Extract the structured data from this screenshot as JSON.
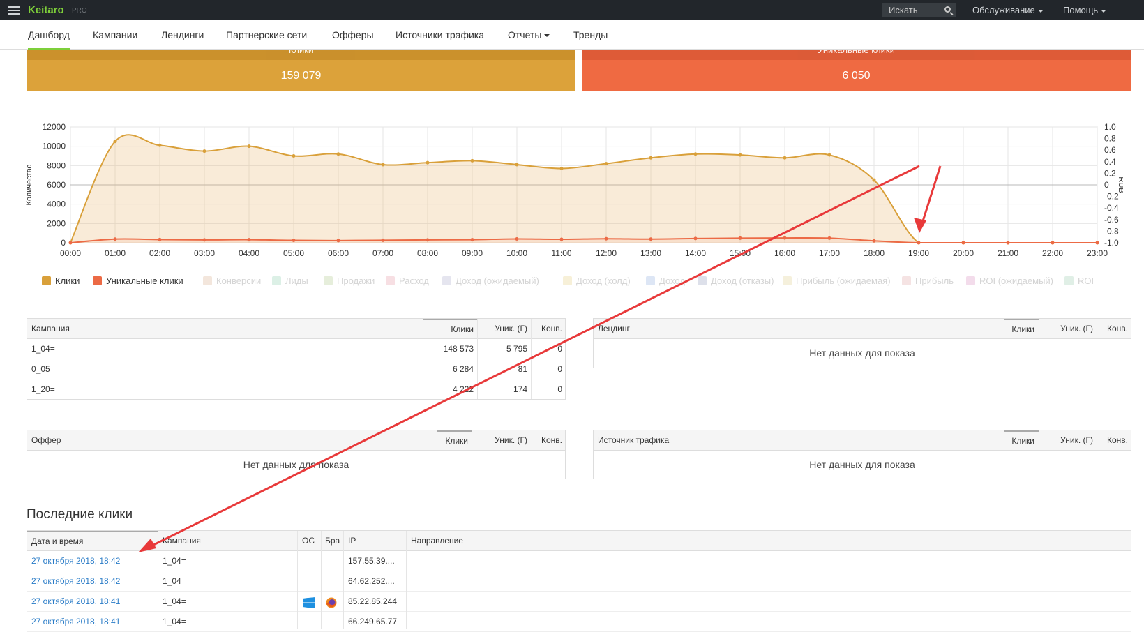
{
  "app": {
    "brand": "Keitaro",
    "edition": "PRO"
  },
  "topnav": {
    "search_label": "Искать",
    "service_label": "Обслуживание",
    "help_label": "Помощь"
  },
  "menu": [
    "Дашборд",
    "Кампании",
    "Лендинги",
    "Партнерские сети",
    "Офферы",
    "Источники трафика",
    "Отчеты",
    "Тренды"
  ],
  "cards": [
    {
      "title": "Клики",
      "value": "159 079"
    },
    {
      "title": "Уникальные клики",
      "value": "6 050"
    }
  ],
  "chart_data": {
    "type": "area",
    "x": [
      "00:00",
      "01:00",
      "02:00",
      "03:00",
      "04:00",
      "05:00",
      "06:00",
      "07:00",
      "08:00",
      "09:00",
      "10:00",
      "11:00",
      "12:00",
      "13:00",
      "14:00",
      "15:00",
      "16:00",
      "17:00",
      "18:00",
      "19:00",
      "20:00",
      "21:00",
      "22:00",
      "23:00"
    ],
    "series": [
      {
        "name": "Клики",
        "values": [
          0,
          10500,
          10100,
          9500,
          10000,
          9000,
          9200,
          8100,
          8300,
          8500,
          8100,
          7700,
          8200,
          8800,
          9200,
          9100,
          8800,
          9100,
          6500,
          0,
          0,
          0,
          0,
          0
        ],
        "color": "#d9a03a"
      },
      {
        "name": "Уникальные клики",
        "values": [
          0,
          380,
          330,
          300,
          320,
          250,
          230,
          260,
          300,
          320,
          400,
          360,
          420,
          380,
          440,
          480,
          500,
          480,
          200,
          0,
          0,
          0,
          0,
          0
        ],
        "color": "#ec6a45"
      }
    ],
    "ylabel": "Количество",
    "y2label": "RUB",
    "ylim": [
      0,
      12000
    ],
    "yticks": [
      0,
      2000,
      4000,
      6000,
      8000,
      10000,
      12000
    ],
    "y2ticks": [
      "-1.0",
      "-0.8",
      "-0.6",
      "-0.4",
      "-0.2",
      "0",
      "0.2",
      "0.4",
      "0.6",
      "0.8",
      "1.0"
    ],
    "grid": true,
    "legend": [
      {
        "label": "Клики",
        "color": "#d9a03a",
        "active": true
      },
      {
        "label": "Уникальные клики",
        "color": "#ec6a45",
        "active": true
      },
      {
        "label": "Конверсии",
        "color": "#f3e6dc",
        "active": false
      },
      {
        "label": "Лиды",
        "color": "#dcf0e6",
        "active": false
      },
      {
        "label": "Продажи",
        "color": "#e6eedb",
        "active": false
      },
      {
        "label": "Расход",
        "color": "#f7dfe3",
        "active": false
      },
      {
        "label": "Доход (ожидаемый)",
        "color": "#e5e5ef",
        "active": false
      },
      {
        "label": "Доход (холд)",
        "color": "#f7f0d8",
        "active": false
      },
      {
        "label": "Доход",
        "color": "#dde6f5",
        "active": false
      },
      {
        "label": "Доход (отказы)",
        "color": "#dde0ea",
        "active": false
      },
      {
        "label": "Прибыль (ожидаемая)",
        "color": "#f5f0dc",
        "active": false
      },
      {
        "label": "Прибыль",
        "color": "#f5e3e3",
        "active": false
      },
      {
        "label": "ROI (ожидаемый)",
        "color": "#f3dceb",
        "active": false
      },
      {
        "label": "ROI",
        "color": "#e0efe6",
        "active": false
      }
    ]
  },
  "campaigns_table": {
    "headers": [
      "Кампания",
      "Клики",
      "Уник. (Г)",
      "Конв."
    ],
    "rows": [
      [
        "1_04=",
        "148 573",
        "5 795",
        "0"
      ],
      [
        "0_05",
        "6 284",
        "81",
        "0"
      ],
      [
        "1_20=",
        "4 222",
        "174",
        "0"
      ]
    ]
  },
  "landings_table": {
    "headers": [
      "Лендинг",
      "Клики",
      "Уник. (Г)",
      "Конв."
    ],
    "empty": "Нет данных для показа"
  },
  "offers_table": {
    "headers": [
      "Оффер",
      "Клики",
      "Уник. (Г)",
      "Конв."
    ],
    "empty": "Нет данных для показа"
  },
  "sources_table": {
    "headers": [
      "Источник трафика",
      "Клики",
      "Уник. (Г)",
      "Конв."
    ],
    "empty": "Нет данных для показа"
  },
  "recent": {
    "title": "Последние клики",
    "headers": [
      "Дата и время",
      "Кампания",
      "ОС",
      "Бра",
      "IP",
      "Направление"
    ],
    "rows": [
      [
        "27 октября 2018, 18:42",
        "1_04=",
        "",
        "",
        "157.55.39...."
      ],
      [
        "27 октября 2018, 18:42",
        "1_04=",
        "",
        "",
        "64.62.252...."
      ],
      [
        "27 октября 2018, 18:41",
        "1_04=",
        "windows-icon",
        "firefox-icon",
        "85.22.85.244"
      ],
      [
        "27 октября 2018, 18:41",
        "1_04=",
        "",
        "",
        "66.249.65.77"
      ]
    ]
  }
}
